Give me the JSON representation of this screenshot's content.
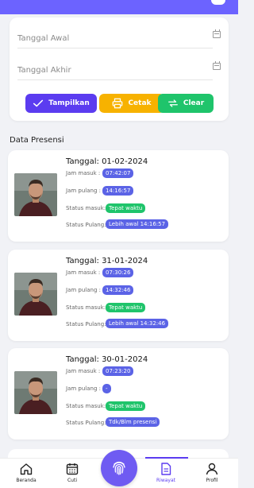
{
  "filter": {
    "start_date_placeholder": "Tanggal Awal",
    "end_date_placeholder": "Tanggal Akhir",
    "buttons": {
      "show": "Tampilkan",
      "print": "Cetak",
      "clear": "Clear"
    }
  },
  "section_title": "Data Presensi",
  "labels": {
    "jam_masuk": "Jam masuk :",
    "jam_pulang": "Jam pulang :",
    "status_masuk": "Status masuk:",
    "status_pulang": "Status Pulang:"
  },
  "records": [
    {
      "date": "Tanggal: 01-02-2024",
      "jam_masuk": "07:42:07",
      "jam_pulang": "14:16:57",
      "status_masuk": "Tepat waktu",
      "status_pulang": "Lebih awal 14:16:57"
    },
    {
      "date": "Tanggal: 31-01-2024",
      "jam_masuk": "07:30:26",
      "jam_pulang": "14:32:46",
      "status_masuk": "Tepat waktu",
      "status_pulang": "Lebih awal 14:32:46"
    },
    {
      "date": "Tanggal: 30-01-2024",
      "jam_masuk": "07:23:20",
      "jam_pulang": "-",
      "status_masuk": "Tepat waktu",
      "status_pulang": "Tdk/Blm presensi"
    }
  ],
  "nav": {
    "home": "Beranda",
    "leave": "Cuti",
    "history": "Riwayat",
    "profile": "Profil"
  },
  "colors": {
    "accent": "#5b3cf0",
    "print": "#f7b200",
    "clear": "#1fc46b",
    "chip_blue": "#5b63e6",
    "chip_green": "#1fc46b"
  }
}
